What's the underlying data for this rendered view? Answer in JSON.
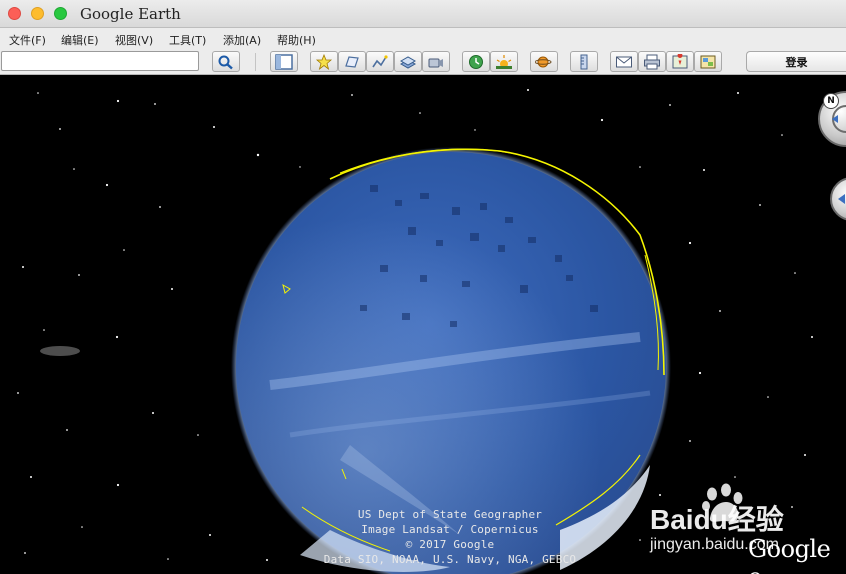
{
  "window": {
    "title": "Google Earth"
  },
  "menu": [
    {
      "label": "文件(F)"
    },
    {
      "label": "编辑(E)"
    },
    {
      "label": "视图(V)"
    },
    {
      "label": "工具(T)"
    },
    {
      "label": "添加(A)"
    },
    {
      "label": "帮助(H)"
    }
  ],
  "toolbar": {
    "search_value": "",
    "login_label": "登录",
    "icons": [
      "search-icon",
      "sidebar-icon",
      "placemark-icon",
      "polygon-icon",
      "path-icon",
      "overlay-icon",
      "tour-icon",
      "history-icon",
      "sunlight-icon",
      "planet-icon",
      "ruler-icon",
      "email-icon",
      "print-icon",
      "maps-icon",
      "save-image-icon"
    ]
  },
  "attribution": {
    "line1": "US Dept of State Geographer",
    "line2": "Image Landsat / Copernicus",
    "line3": "© 2017 Google",
    "line4": "Data SIO, NOAA, U.S. Navy, NGA, GEBCO"
  },
  "watermark": {
    "brand": "Baidu经验",
    "url": "jingyan.baidu.com"
  },
  "logo": "Google e",
  "nav": {
    "north_label": "N"
  },
  "colors": {
    "ocean": "#2d59a8",
    "coastline": "#f5f500",
    "atmosphere": "#9ec3ff",
    "toolbar_bg": "#ececec"
  }
}
